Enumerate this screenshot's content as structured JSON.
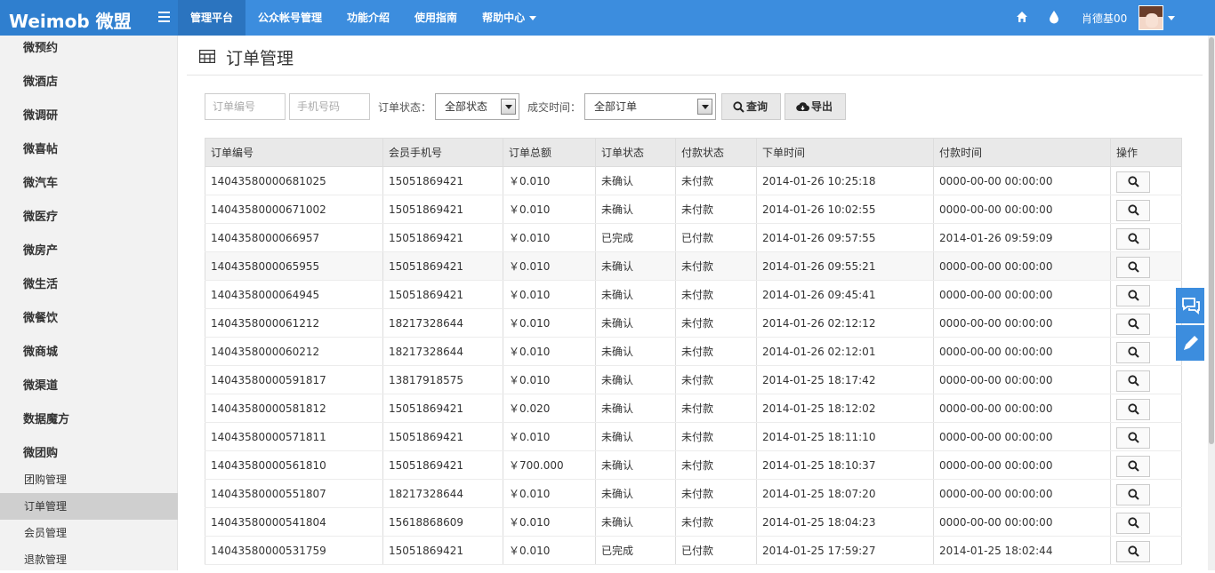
{
  "brand": {
    "logo_text": "Weimob 微盟"
  },
  "nav": [
    {
      "label": "管理平台",
      "active": true
    },
    {
      "label": "公众帐号管理"
    },
    {
      "label": "功能介绍"
    },
    {
      "label": "使用指南"
    },
    {
      "label": "帮助中心",
      "dropdown": true
    }
  ],
  "user": {
    "name": "肖德基00"
  },
  "sidebar": {
    "items": [
      "微预约",
      "微酒店",
      "微调研",
      "微喜帖",
      "微汽车",
      "微医疗",
      "微房产",
      "微生活",
      "微餐饮",
      "微商城",
      "微渠道",
      "数据魔方",
      "微团购"
    ],
    "subitems": [
      {
        "label": "团购管理"
      },
      {
        "label": "订单管理",
        "active": true
      },
      {
        "label": "会员管理"
      },
      {
        "label": "退款管理"
      }
    ]
  },
  "page": {
    "title": "订单管理"
  },
  "filters": {
    "order_no_placeholder": "订单编号",
    "phone_placeholder": "手机号码",
    "status_label": "订单状态：",
    "status_value": "全部状态",
    "time_label": "成交时间：",
    "time_value": "全部订单",
    "search_label": "查询",
    "export_label": "导出"
  },
  "table": {
    "headers": [
      "订单编号",
      "会员手机号",
      "订单总额",
      "订单状态",
      "付款状态",
      "下单时间",
      "付款时间",
      "操作"
    ],
    "rows": [
      [
        "14043580000681025",
        "15051869421",
        "￥0.010",
        "未确认",
        "未付款",
        "2014-01-26 10:25:18",
        "0000-00-00 00:00:00"
      ],
      [
        "14043580000671002",
        "15051869421",
        "￥0.010",
        "未确认",
        "未付款",
        "2014-01-26 10:02:55",
        "0000-00-00 00:00:00"
      ],
      [
        "1404358000066957",
        "15051869421",
        "￥0.010",
        "已完成",
        "已付款",
        "2014-01-26 09:57:55",
        "2014-01-26 09:59:09"
      ],
      [
        "1404358000065955",
        "15051869421",
        "￥0.010",
        "未确认",
        "未付款",
        "2014-01-26 09:55:21",
        "0000-00-00 00:00:00"
      ],
      [
        "1404358000064945",
        "15051869421",
        "￥0.010",
        "未确认",
        "未付款",
        "2014-01-26 09:45:41",
        "0000-00-00 00:00:00"
      ],
      [
        "1404358000061212",
        "18217328644",
        "￥0.010",
        "未确认",
        "未付款",
        "2014-01-26 02:12:12",
        "0000-00-00 00:00:00"
      ],
      [
        "1404358000060212",
        "18217328644",
        "￥0.010",
        "未确认",
        "未付款",
        "2014-01-26 02:12:01",
        "0000-00-00 00:00:00"
      ],
      [
        "14043580000591817",
        "13817918575",
        "￥0.010",
        "未确认",
        "未付款",
        "2014-01-25 18:17:42",
        "0000-00-00 00:00:00"
      ],
      [
        "14043580000581812",
        "15051869421",
        "￥0.020",
        "未确认",
        "未付款",
        "2014-01-25 18:12:02",
        "0000-00-00 00:00:00"
      ],
      [
        "14043580000571811",
        "15051869421",
        "￥0.010",
        "未确认",
        "未付款",
        "2014-01-25 18:11:10",
        "0000-00-00 00:00:00"
      ],
      [
        "14043580000561810",
        "15051869421",
        "￥700.000",
        "未确认",
        "未付款",
        "2014-01-25 18:10:37",
        "0000-00-00 00:00:00"
      ],
      [
        "14043580000551807",
        "18217328644",
        "￥0.010",
        "未确认",
        "未付款",
        "2014-01-25 18:07:20",
        "0000-00-00 00:00:00"
      ],
      [
        "14043580000541804",
        "15618868609",
        "￥0.010",
        "未确认",
        "未付款",
        "2014-01-25 18:04:23",
        "0000-00-00 00:00:00"
      ],
      [
        "14043580000531759",
        "15051869421",
        "￥0.010",
        "已完成",
        "已付款",
        "2014-01-25 17:59:27",
        "2014-01-25 18:02:44"
      ]
    ]
  },
  "icons": {
    "menu": "hamburger-icon",
    "home": "home-icon",
    "drop": "water-drop-icon",
    "table": "table-icon",
    "search": "search-icon",
    "export": "cloud-download-icon",
    "chat": "chat-bubbles-icon",
    "edit": "pencil-icon"
  },
  "colors": {
    "topbar": "#3c8dde",
    "brand_bg": "#2f7fcf",
    "nav_active": "#2b74bf",
    "sidebar_bg": "#f2f2f2",
    "sidebar_active": "#cfcfcf"
  }
}
